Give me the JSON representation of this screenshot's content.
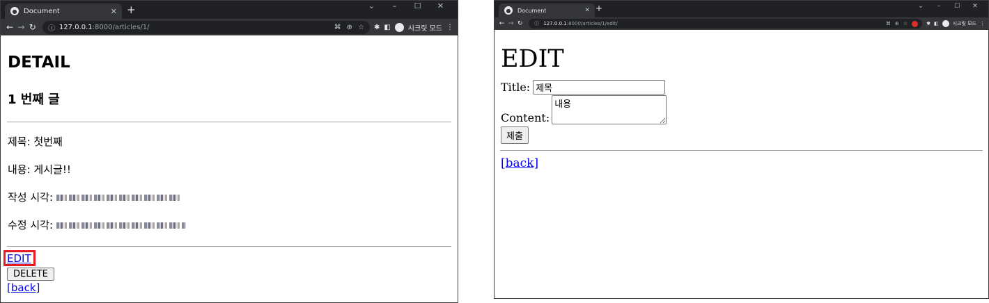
{
  "left_window": {
    "tab_title": "Document",
    "url_host": "127.0.0.1",
    "url_path": ":8000/articles/1/",
    "incognito_label": "시크릿 모드",
    "heading": "DETAIL",
    "subheading": "1 번째 글",
    "title_line": "제목: 첫번째",
    "content_line": "내용: 게시글!!",
    "created_label": "작성 시각:",
    "updated_label": "수정 시각:",
    "edit_link": "EDIT",
    "delete_button": "DELETE",
    "back_link": "[back]"
  },
  "right_window": {
    "tab_title": "Document",
    "url_host": "127.0.0.1",
    "url_path": ":8000/articles/1/edit/",
    "incognito_label": "시크릿 모드",
    "heading": "EDIT",
    "title_label": "Title:",
    "title_value": "제목",
    "content_label": "Content:",
    "content_value": "내용",
    "submit_button": "제출",
    "back_link": "[back]"
  },
  "colors": {
    "highlight_box": "#e31b23",
    "link": "#0000ee",
    "chrome_tabstrip": "#202124",
    "chrome_toolbar": "#35363a"
  },
  "icons": [
    "chrome-favicon",
    "close-icon",
    "new-tab-icon",
    "back-arrow-icon",
    "forward-arrow-icon",
    "reload-icon",
    "info-icon",
    "translate-icon",
    "zoom-icon",
    "star-icon",
    "extensions-icon",
    "sidepanel-icon",
    "incognito-icon",
    "menu-icon"
  ]
}
